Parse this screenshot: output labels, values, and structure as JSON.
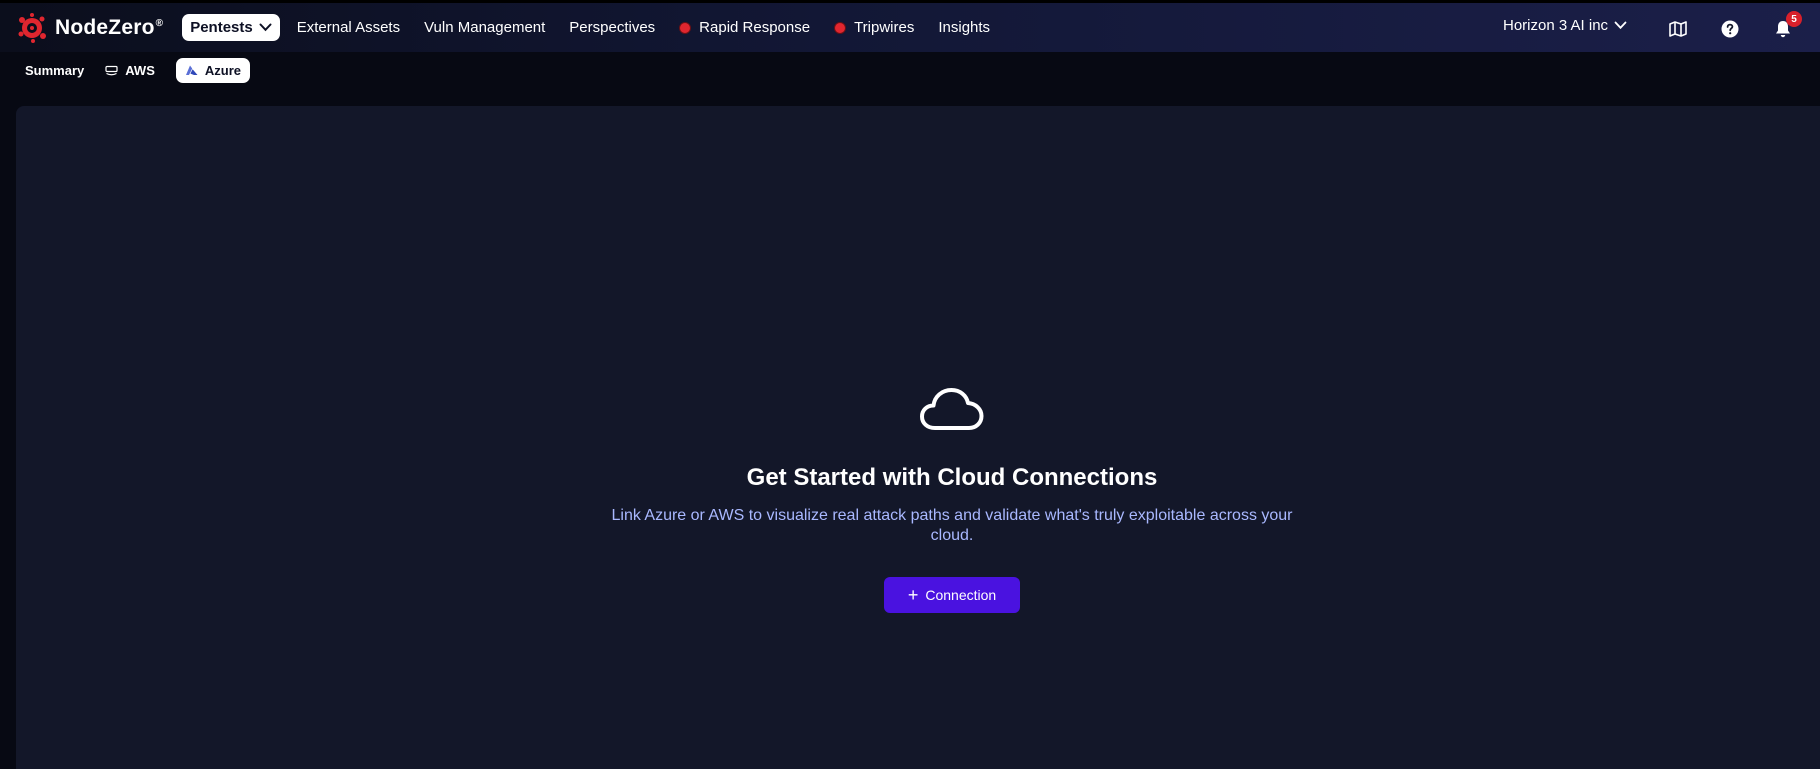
{
  "brand": {
    "name": "NodeZero",
    "reg": "®"
  },
  "nav": {
    "pentests": "Pentests",
    "external_assets": "External Assets",
    "vuln_management": "Vuln Management",
    "perspectives": "Perspectives",
    "rapid_response": "Rapid Response",
    "tripwires": "Tripwires",
    "insights": "Insights"
  },
  "org": {
    "name": "Horizon 3 AI inc"
  },
  "notifications": {
    "count": "5"
  },
  "subnav": {
    "summary": "Summary",
    "aws": "AWS",
    "azure": "Azure",
    "active": "Azure"
  },
  "empty_state": {
    "title": "Get Started with Cloud Connections",
    "description": "Link Azure or AWS to visualize real attack paths and validate what's truly exploitable across your cloud.",
    "button_label": "Connection"
  },
  "icons": [
    "nodezero-logo-icon",
    "chevron-down-icon",
    "map-icon",
    "help-icon",
    "bell-icon",
    "aws-icon",
    "azure-icon",
    "cloud-icon",
    "plus-icon"
  ],
  "colors": {
    "accent": "#4a12e0",
    "status_red": "#e0262f",
    "link_text": "#a9b8ff"
  }
}
